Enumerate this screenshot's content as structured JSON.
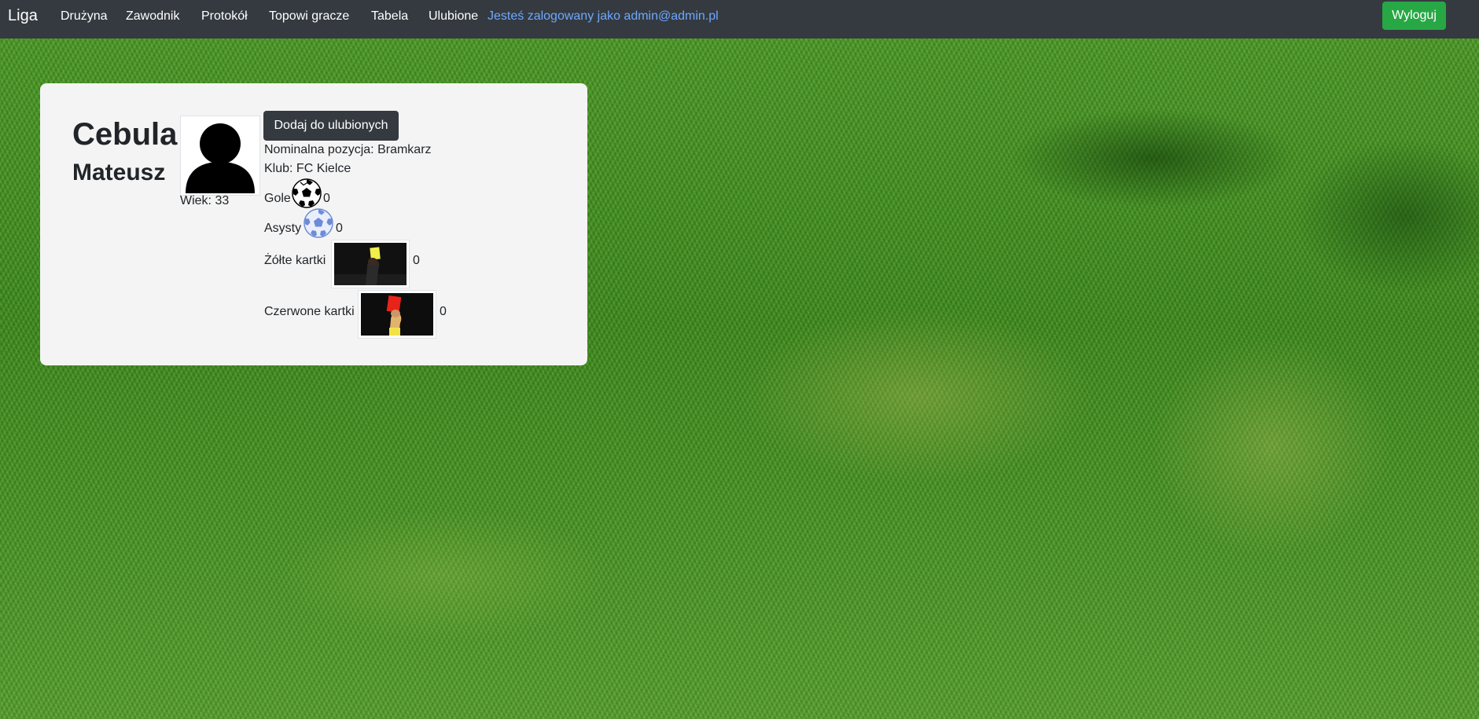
{
  "navbar": {
    "brand": "Liga",
    "links": [
      "Drużyna",
      "Zawodnik",
      "Protokół",
      "Topowi gracze",
      "Tabela",
      "Ulubione"
    ],
    "logged_in_text": "Jesteś zalogowany jako admin@admin.pl",
    "logout_label": "Wyloguj",
    "colors": {
      "background": "#343a40",
      "logged_in": "#6ea8fe",
      "logout": "#28a745"
    }
  },
  "player": {
    "surname": "Cebula",
    "firstname": "Mateusz",
    "age_text": "Wiek: 33",
    "favorite_button": "Dodaj do ulubionych",
    "position_text": "Nominalna pozycja: Bramkarz",
    "club_text": "Klub: FC Kielce",
    "stats": {
      "goals_label": "Gole",
      "goals_value": "0",
      "goals_icon": "soccer-ball-icon",
      "assists_label": "Asysty",
      "assists_value": "0",
      "assists_icon": "blue-soccer-ball-icon",
      "yellow_label": "Żółte kartki",
      "yellow_value": "0",
      "yellow_image": "yellow-card-photo",
      "red_label": "Czerwone kartki",
      "red_value": "0",
      "red_image": "red-card-photo"
    }
  }
}
